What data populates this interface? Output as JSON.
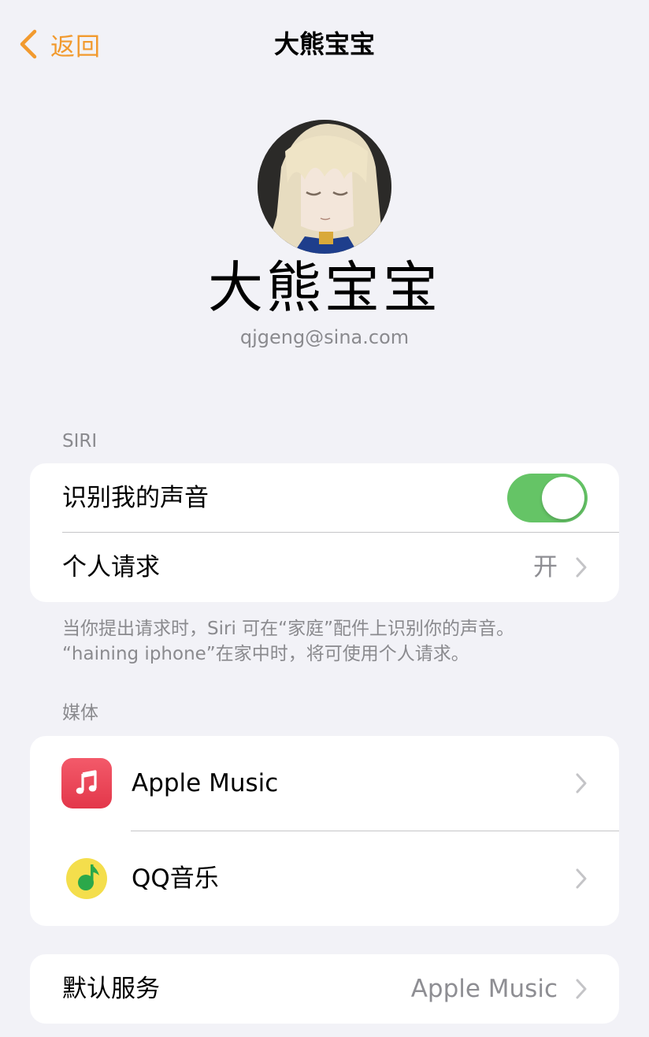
{
  "nav": {
    "back_label": "返回",
    "title": "大熊宝宝"
  },
  "profile": {
    "name": "大熊宝宝",
    "email": "qjgeng@sina.com"
  },
  "siri": {
    "header": "SIRI",
    "recognize_voice_label": "识别我的声音",
    "recognize_voice_enabled": true,
    "personal_requests_label": "个人请求",
    "personal_requests_value": "开",
    "footnote_line1": "当你提出请求时，Siri 可在“家庭”配件上识别你的声音。",
    "footnote_line2": "“haining iphone”在家中时，将可使用个人请求。"
  },
  "media": {
    "header": "媒体",
    "items": [
      {
        "label": "Apple Music",
        "icon": "apple-music-icon"
      },
      {
        "label": "QQ音乐",
        "icon": "qq-music-icon"
      }
    ]
  },
  "default_service": {
    "label": "默认服务",
    "value": "Apple Music"
  },
  "colors": {
    "accent": "#f29a2e",
    "toggle_on": "#65c466",
    "background": "#f2f2f7",
    "secondary_text": "#8a8a8e"
  }
}
